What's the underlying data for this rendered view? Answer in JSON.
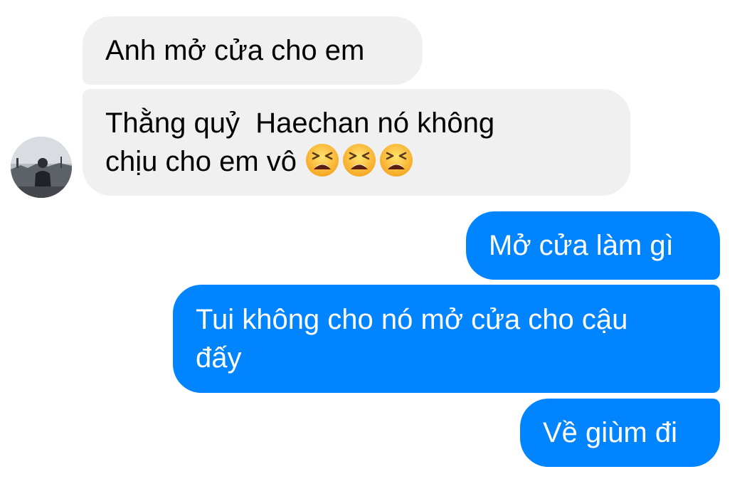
{
  "conversation": {
    "messages": [
      {
        "direction": "incoming",
        "text": "Anh mở cửa cho em"
      },
      {
        "direction": "incoming",
        "text": "Thằng quỷ  Haechan nó không\nchịu cho em vô",
        "emoji": [
          "tired-face",
          "tired-face",
          "tired-face"
        ]
      },
      {
        "direction": "outgoing",
        "text": "Mở cửa làm gì"
      },
      {
        "direction": "outgoing",
        "text": "Tui không cho nó mở cửa cho cậu\nđấy"
      },
      {
        "direction": "outgoing",
        "text": "Về giùm đi"
      }
    ]
  },
  "colors": {
    "incoming_bubble": "#f1f0f0",
    "outgoing_bubble": "#0084ff",
    "incoming_text": "#000000",
    "outgoing_text": "#ffffff"
  },
  "icons": {
    "avatar": "contact-avatar-photo",
    "emoji": "tired-face-emoji"
  }
}
